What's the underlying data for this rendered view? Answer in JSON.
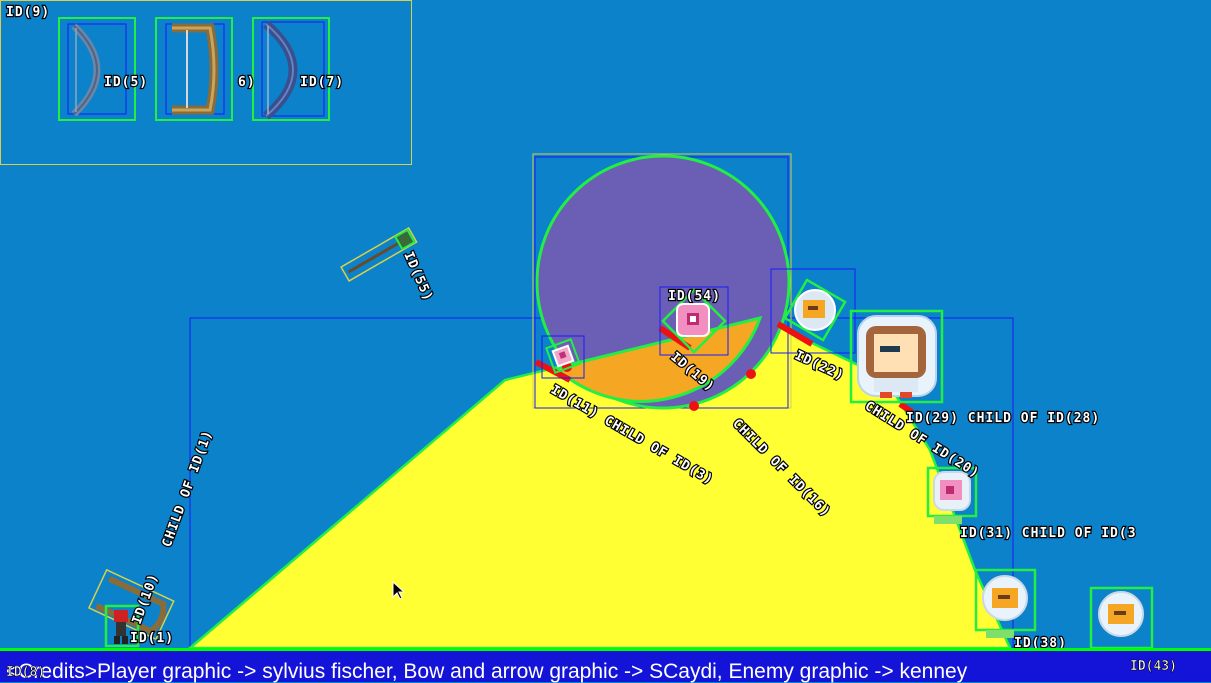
{
  "colors": {
    "background": "#0b82c9",
    "terrain": "#ffff33",
    "collider": "#22ee44",
    "bounds": "#1a1aff",
    "circle_body": "#6a5fb5",
    "orange_body": "#f5a623",
    "contact": "#ee1111",
    "credits_bar": "#1414d8"
  },
  "labels": {
    "id9": "ID(9)",
    "id5": "ID(5)",
    "id6": "6)",
    "id7": "ID(7)",
    "id55": "ID(55)",
    "id54": "ID(54)",
    "id1_child": "CHILD OF ID(1)",
    "id10": "ID(10)",
    "id1": "ID(1)",
    "id11_child": "ID(11) CHILD OF ID(3)",
    "id19": "ID(19)",
    "child_of_16": "CHILD OF ID(16)",
    "id22": "ID(22)",
    "child_of_20": "CHILD OF ID(20)",
    "id29_child": "ID(29) CHILD OF ID(28)",
    "id31_child": "ID(31) CHILD OF ID(3",
    "id38": "ID(38)",
    "id43": "ID(43)"
  },
  "credits": {
    "text": "<Credits>Player graphic -> sylvius fischer, Bow and arrow graphic -> SCaydi, Enemy graphic -> kenney",
    "id_label": "ID(8)",
    "id_right": "ID(43)"
  },
  "icons": [
    "bow-icon",
    "player-sprite",
    "enemy-astronaut-sprite",
    "pink-creature-sprite",
    "arrow-icon",
    "mouse-cursor-icon"
  ]
}
